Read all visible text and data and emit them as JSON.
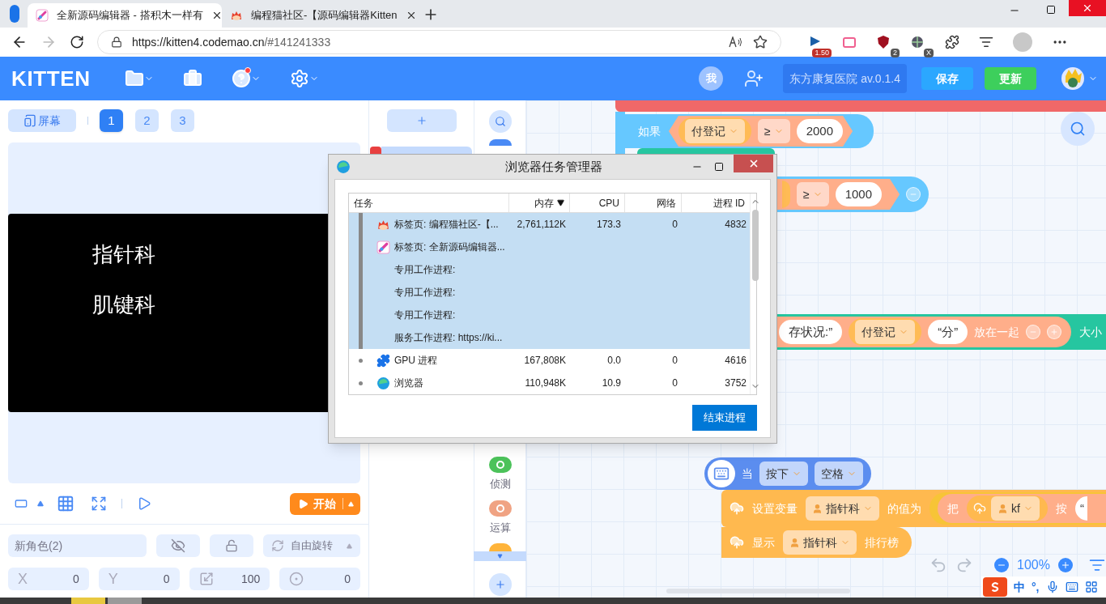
{
  "browser": {
    "tabs": [
      {
        "title": "全新源码编辑器 - 搭积木一样有",
        "kind": "kitten",
        "selected": true
      },
      {
        "title": "编程猫社区-【源码编辑器Kitten",
        "kind": "cat",
        "selected": false
      }
    ],
    "url_host": "https://kitten4.codemao.cn",
    "url_path": "/#141241333",
    "extensions": [
      {
        "kind": "flag",
        "badge": "1.50"
      },
      {
        "kind": "tv"
      },
      {
        "kind": "shield",
        "badge": "2"
      },
      {
        "kind": "globe",
        "badge": "X"
      }
    ]
  },
  "header": {
    "logo": "KITTEN",
    "has_notification": true,
    "user_initial": "我",
    "project": "东方康复医院 av.0.1.4",
    "save": "保存",
    "update": "更新"
  },
  "stage": {
    "screen_button": "屏幕",
    "pages": [
      {
        "label": "1",
        "selected": true
      },
      {
        "label": "2",
        "selected": false
      },
      {
        "label": "3",
        "selected": false
      }
    ],
    "texts": [
      "指针科",
      "肌键科"
    ],
    "start": "开始"
  },
  "sprite": {
    "name": "新角色(2)",
    "visible": false,
    "locked": false,
    "rotation": "自由旋转",
    "fields": [
      {
        "kind": "letter",
        "label": "X",
        "value": "0"
      },
      {
        "kind": "letter",
        "label": "Y",
        "value": "0"
      },
      {
        "kind": "scale",
        "value": "100"
      },
      {
        "kind": "direction",
        "value": "0"
      }
    ]
  },
  "categories": [
    {
      "label": "侦测",
      "color": "#4cc25a"
    },
    {
      "label": "运算",
      "color": "#f0a383"
    }
  ],
  "blocks": {
    "if_1": {
      "keyword": "如果",
      "variable": "付登记",
      "operator": "≥",
      "value": "2000"
    },
    "if_2": {
      "operator": "≥",
      "value": "1000"
    },
    "join": {
      "text": "存状况:”",
      "variable": "付登记",
      "string": "“分”",
      "keyword": "放在一起",
      "tail": "大小"
    },
    "event": {
      "keyword": "当",
      "action": "按下",
      "key": "空格"
    },
    "set_var": {
      "keyword": "设置变量",
      "variable": "指针科",
      "suffix": "的值为",
      "inner_keyword": "把",
      "inner_variable": "kf",
      "inner_suffix": "按",
      "string": "“"
    },
    "show": {
      "keyword": "显示",
      "variable": "指针科",
      "suffix": "排行榜"
    }
  },
  "zoom": "100%",
  "ime": {
    "label": "中",
    "punct": "°,"
  },
  "task_manager": {
    "title": "浏览器任务管理器",
    "columns": [
      {
        "label": "任务",
        "sorted": false
      },
      {
        "label": "内存",
        "sorted": true
      },
      {
        "label": "CPU",
        "sorted": false
      },
      {
        "label": "网络",
        "sorted": false
      },
      {
        "label": "进程 ID",
        "sorted": false
      }
    ],
    "rows": [
      {
        "task": "标签页: 编程猫社区-【...",
        "kind": "cat",
        "memory": "2,761,112K",
        "cpu": "173.3",
        "network": "0",
        "pid": "4832",
        "selected": true
      },
      {
        "task": "标签页: 全新源码编辑器...",
        "kind": "kitten",
        "selected": true
      },
      {
        "task": "专用工作进程:",
        "kind": "worker",
        "selected": true
      },
      {
        "task": "专用工作进程:",
        "kind": "worker",
        "selected": true
      },
      {
        "task": "专用工作进程:",
        "kind": "worker",
        "selected": true
      },
      {
        "task": "服务工作进程: https://ki...",
        "kind": "worker",
        "selected": true
      },
      {
        "task": "GPU 进程",
        "kind": "puzzle",
        "memory": "167,808K",
        "cpu": "0.0",
        "network": "0",
        "pid": "4616",
        "selected": false
      },
      {
        "task": "浏览器",
        "kind": "edge",
        "memory": "110,948K",
        "cpu": "10.9",
        "network": "0",
        "pid": "3752",
        "selected": false
      }
    ],
    "end_button": "结束进程"
  }
}
